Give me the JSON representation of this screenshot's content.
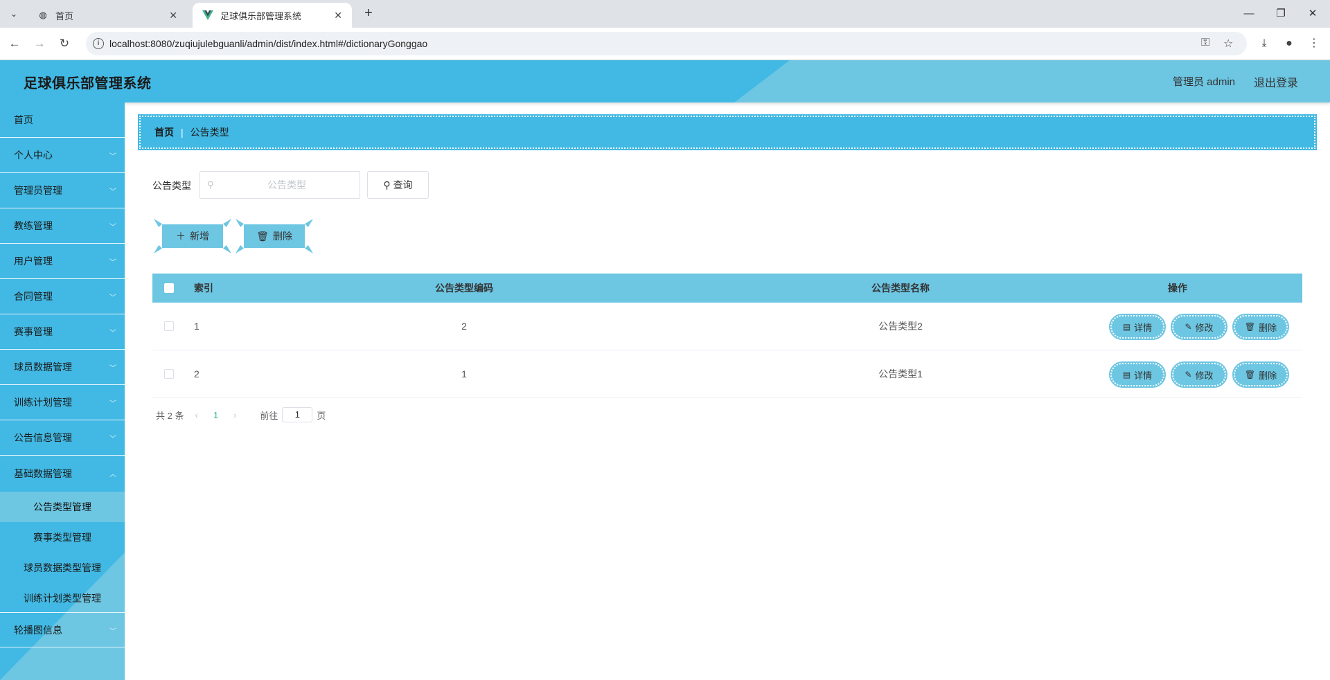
{
  "browser": {
    "tabs": [
      {
        "title": "首页",
        "active": false
      },
      {
        "title": "足球俱乐部管理系统",
        "active": true
      }
    ],
    "url": "localhost:8080/zuqiujulebguanli/admin/dist/index.html#/dictionaryGonggao"
  },
  "header": {
    "title": "足球俱乐部管理系统",
    "user": "管理员 admin",
    "logout": "退出登录"
  },
  "sidebar": {
    "items": [
      {
        "label": "首页",
        "expandable": false
      },
      {
        "label": "个人中心",
        "expandable": true
      },
      {
        "label": "管理员管理",
        "expandable": true
      },
      {
        "label": "教练管理",
        "expandable": true
      },
      {
        "label": "用户管理",
        "expandable": true
      },
      {
        "label": "合同管理",
        "expandable": true
      },
      {
        "label": "赛事管理",
        "expandable": true
      },
      {
        "label": "球员数据管理",
        "expandable": true
      },
      {
        "label": "训练计划管理",
        "expandable": true
      },
      {
        "label": "公告信息管理",
        "expandable": true
      },
      {
        "label": "基础数据管理",
        "expandable": true,
        "expanded": true
      },
      {
        "label": "轮播图信息",
        "expandable": true
      }
    ],
    "subitems": [
      {
        "label": "公告类型管理",
        "active": true
      },
      {
        "label": "赛事类型管理",
        "active": false
      },
      {
        "label": "球员数据类型管理",
        "active": false
      },
      {
        "label": "训练计划类型管理",
        "active": false
      }
    ]
  },
  "breadcrumb": {
    "home": "首页",
    "separator": "|",
    "current": "公告类型"
  },
  "search": {
    "label": "公告类型",
    "placeholder": "公告类型",
    "value": "",
    "button": "查询"
  },
  "actions": {
    "add": "新增",
    "delete": "删除"
  },
  "table": {
    "headers": {
      "index": "索引",
      "code": "公告类型编码",
      "name": "公告类型名称",
      "ops": "操作"
    },
    "rows": [
      {
        "index": "1",
        "code": "2",
        "name": "公告类型2"
      },
      {
        "index": "2",
        "code": "1",
        "name": "公告类型1"
      }
    ],
    "row_actions": {
      "detail": "详情",
      "edit": "修改",
      "delete": "删除"
    }
  },
  "pagination": {
    "total": "共 2 条",
    "current_page": "1",
    "goto_label": "前往",
    "goto_value": "1",
    "page_suffix": "页"
  },
  "colors": {
    "primary": "#42b9e4",
    "accent": "#6dc6e2"
  }
}
